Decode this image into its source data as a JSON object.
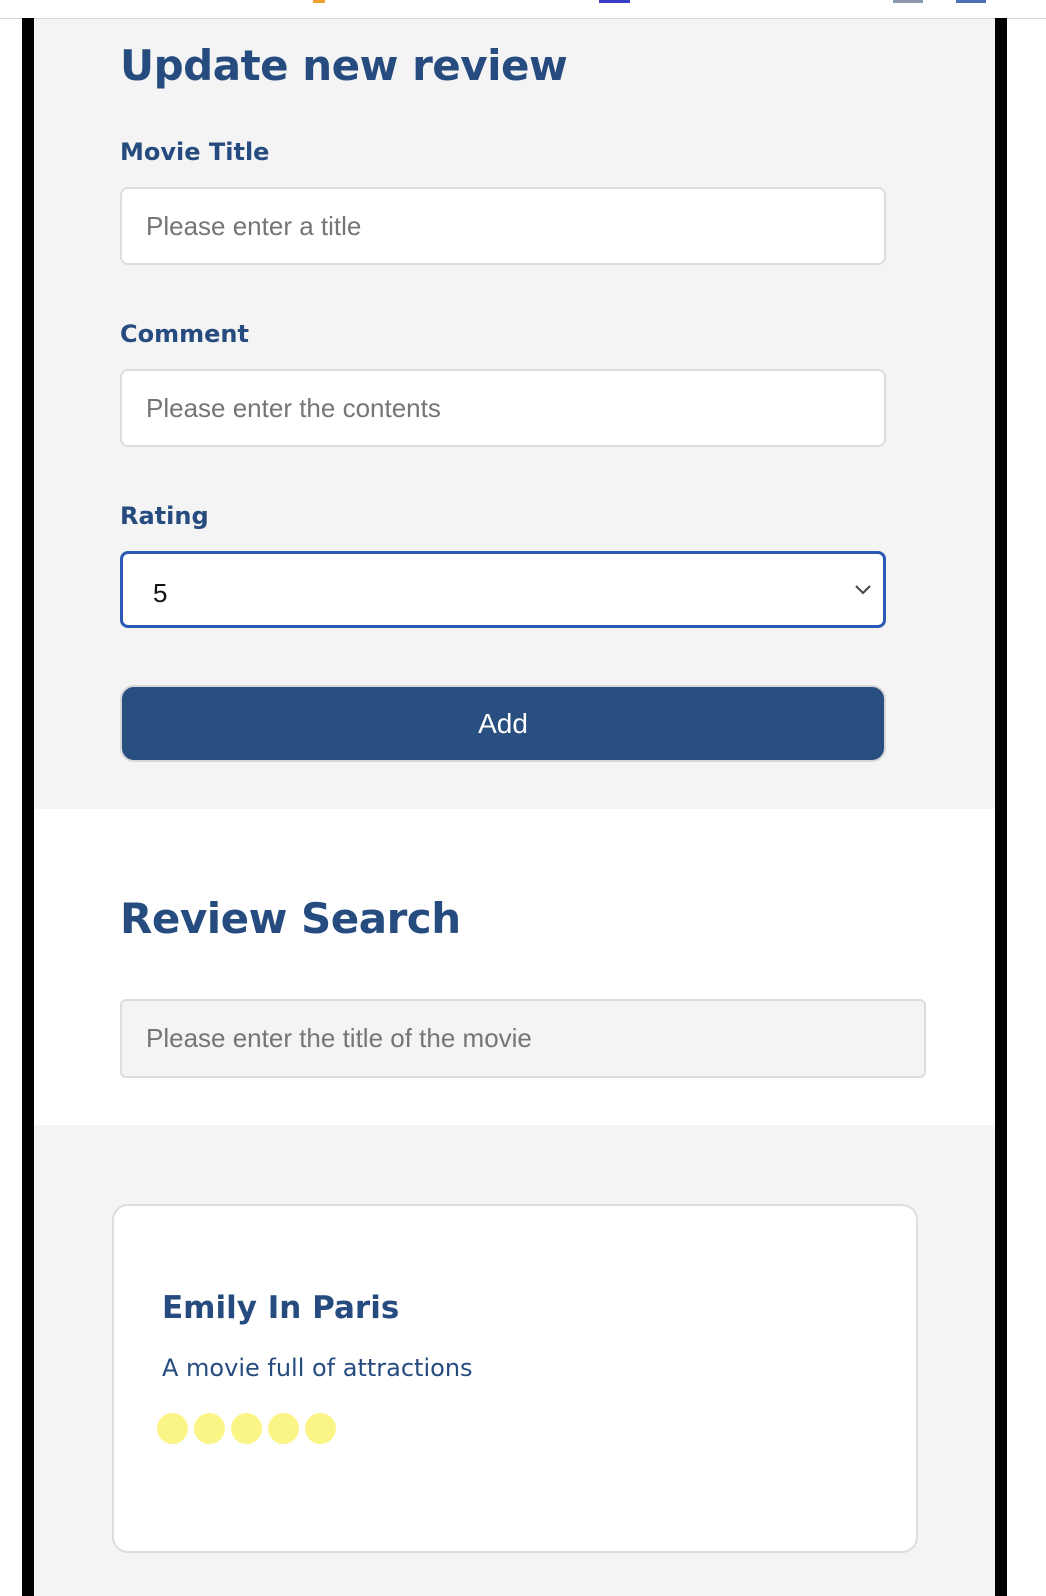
{
  "form": {
    "heading": "Update new review",
    "title_label": "Movie Title",
    "title_placeholder": "Please enter a title",
    "title_value": "",
    "comment_label": "Comment",
    "comment_placeholder": "Please enter the contents",
    "comment_value": "",
    "rating_label": "Rating",
    "rating_selected": "5",
    "submit_label": "Add"
  },
  "search": {
    "heading": "Review Search",
    "placeholder": "Please enter the title of the movie",
    "value": ""
  },
  "reviews": [
    {
      "title": "Emily In Paris",
      "comment": "A movie full of attractions",
      "rating": 5,
      "rating_max": 5
    }
  ],
  "colors": {
    "heading": "#254b7f",
    "button_bg": "#294e80",
    "select_focus_border": "#2a5ab5",
    "section_bg": "#f4f4f4",
    "rating_dot": "#fbf587"
  },
  "icons": {
    "select_arrow": "chevron-down-icon",
    "rating_marker": "rating-dot-icon"
  }
}
